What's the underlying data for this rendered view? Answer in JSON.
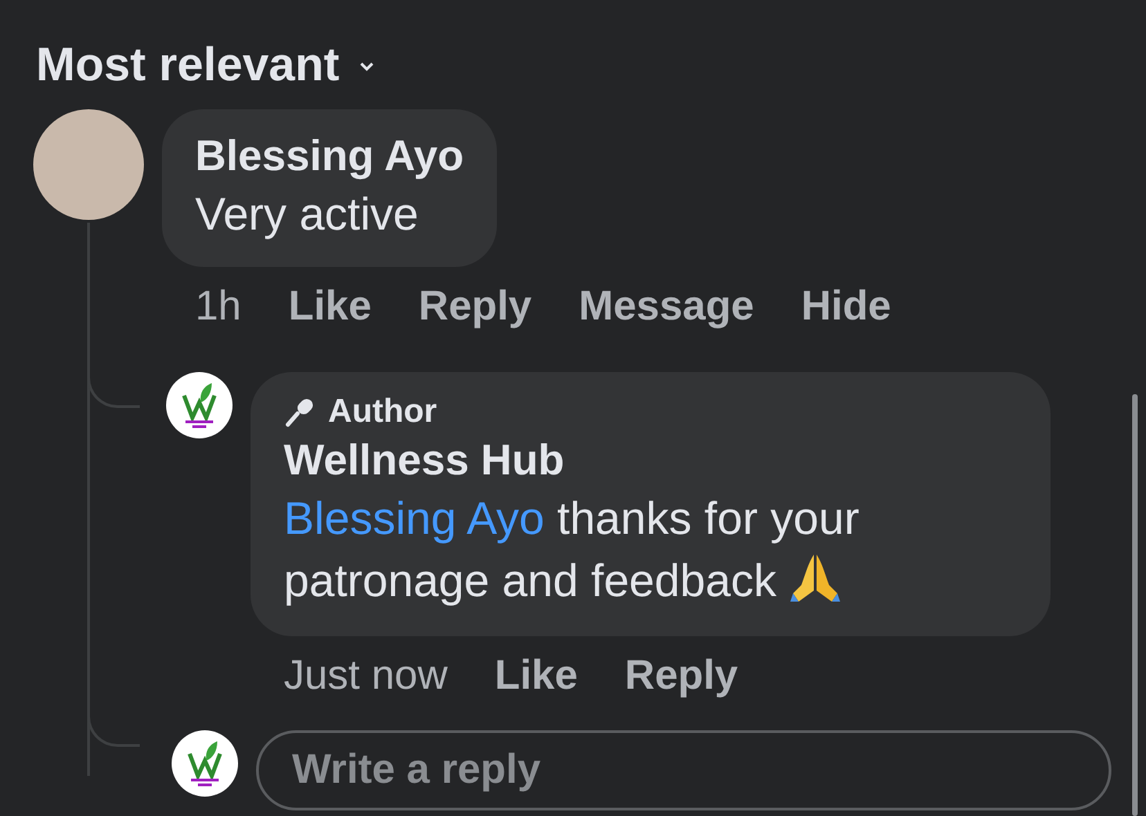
{
  "sort": {
    "label": "Most relevant"
  },
  "comments": [
    {
      "author": "Blessing Ayo",
      "text": "Very active",
      "actions": [
        "1h",
        "Like",
        "Reply",
        "Message",
        "Hide"
      ],
      "replies": [
        {
          "badge": "Author",
          "author": "Wellness Hub",
          "mention": "Blessing Ayo",
          "text": "thanks for your patronage and feedback",
          "actions": [
            "Just now",
            "Like",
            "Reply"
          ]
        }
      ]
    }
  ],
  "reply_field": {
    "placeholder": "Write a reply"
  }
}
